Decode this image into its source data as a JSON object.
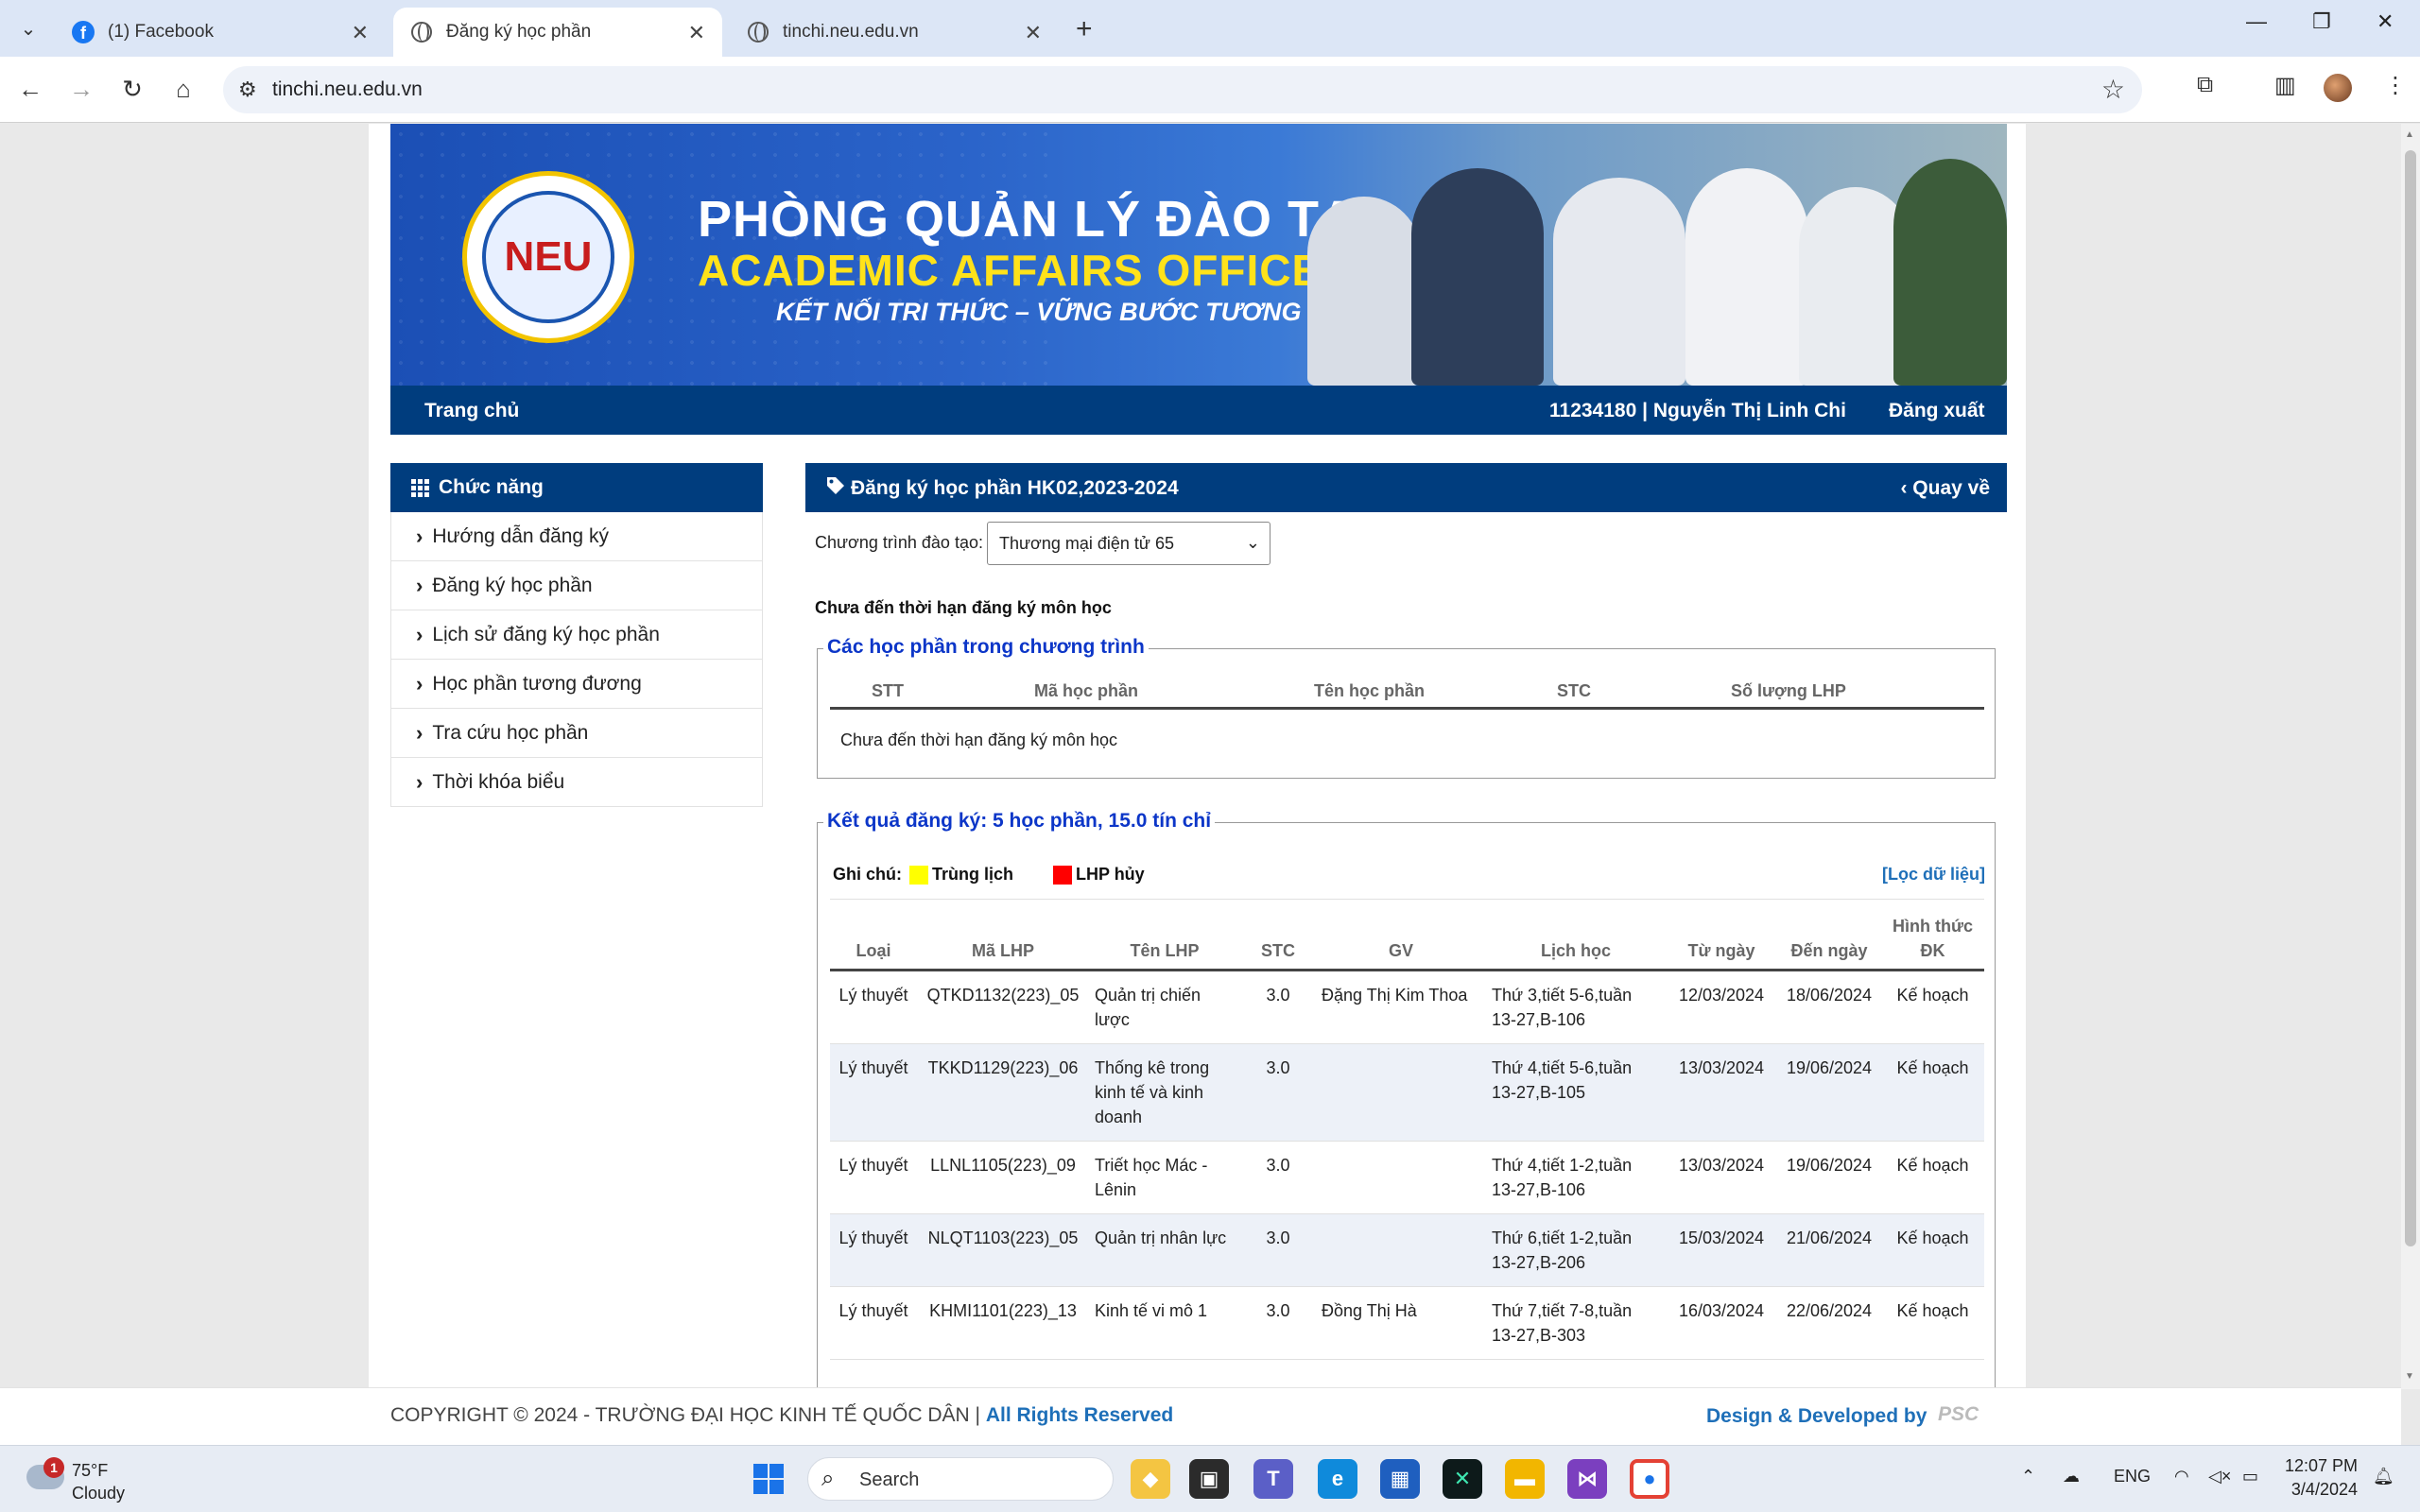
{
  "browser": {
    "tabs": [
      {
        "title": "(1) Facebook",
        "icon": "facebook-icon"
      },
      {
        "title": "Đăng ký học phần",
        "icon": "globe-icon"
      },
      {
        "title": "tinchi.neu.edu.vn",
        "icon": "globe-icon"
      }
    ],
    "url": "tinchi.neu.edu.vn"
  },
  "banner": {
    "line1": "PHÒNG QUẢN LÝ ĐÀO TẠO",
    "line2": "ACADEMIC AFFAIRS OFFICE",
    "line3": "KẾT NỐI TRI THỨC – VỮNG BƯỚC TƯƠNG LAI",
    "logo_text": "NEU"
  },
  "nav": {
    "home": "Trang chủ",
    "user": "11234180 | Nguyễn Thị Linh Chi",
    "logout": "Đăng xuất"
  },
  "sidebar": {
    "title": "Chức năng",
    "items": [
      {
        "label": "Hướng dẫn đăng ký"
      },
      {
        "label": "Đăng ký học phần"
      },
      {
        "label": "Lịch sử đăng ký học phần"
      },
      {
        "label": "Học phần tương đương"
      },
      {
        "label": "Tra cứu học phần"
      },
      {
        "label": "Thời khóa biểu"
      }
    ]
  },
  "main": {
    "title": "Đăng ký học phần HK02,2023-2024",
    "back": "Quay về",
    "program_label": "Chương trình đào tạo:",
    "program_value": "Thương mại điện tử 65",
    "notice": "Chưa đến thời hạn đăng ký môn học",
    "courses_section": {
      "legend": "Các học phần trong chương trình",
      "headers": [
        "STT",
        "Mã học phần",
        "Tên học phần",
        "STC",
        "Số lượng LHP"
      ],
      "empty_text": "Chưa đến thời hạn đăng ký môn học"
    },
    "results_section": {
      "legend": "Kết quả đăng ký: 5 học phần, 15.0 tín chỉ",
      "note_label": "Ghi chú:",
      "note_conflict": "Trùng lịch",
      "note_cancel": "LHP hủy",
      "conflict_color": "#ffff00",
      "cancel_color": "#ff0000",
      "filter": "[Lọc dữ liệu]",
      "headers": [
        "Loại",
        "Mã LHP",
        "Tên LHP",
        "STC",
        "GV",
        "Lịch học",
        "Từ ngày",
        "Đến ngày",
        "Hình thức ĐK"
      ],
      "rows": [
        {
          "type": "Lý thuyết",
          "code": "QTKD1132(223)_05",
          "name": "Quản trị chiến lược",
          "stc": "3.0",
          "gv": "Đặng Thị Kim Thoa",
          "schedule": "Thứ 3,tiết 5-6,tuần 13-27,B-106",
          "from": "12/03/2024",
          "to": "18/06/2024",
          "form": "Kế hoạch"
        },
        {
          "type": "Lý thuyết",
          "code": "TKKD1129(223)_06",
          "name": "Thống kê trong kinh tế và kinh doanh",
          "stc": "3.0",
          "gv": "",
          "schedule": "Thứ 4,tiết 5-6,tuần 13-27,B-105",
          "from": "13/03/2024",
          "to": "19/06/2024",
          "form": "Kế hoạch"
        },
        {
          "type": "Lý thuyết",
          "code": "LLNL1105(223)_09",
          "name": "Triết học Mác - Lênin",
          "stc": "3.0",
          "gv": "",
          "schedule": "Thứ 4,tiết 1-2,tuần 13-27,B-106",
          "from": "13/03/2024",
          "to": "19/06/2024",
          "form": "Kế hoạch"
        },
        {
          "type": "Lý thuyết",
          "code": "NLQT1103(223)_05",
          "name": "Quản trị nhân lực",
          "stc": "3.0",
          "gv": "",
          "schedule": "Thứ 6,tiết 1-2,tuần 13-27,B-206",
          "from": "15/03/2024",
          "to": "21/06/2024",
          "form": "Kế hoạch"
        },
        {
          "type": "Lý thuyết",
          "code": "KHMI1101(223)_13",
          "name": "Kinh tế vi mô 1",
          "stc": "3.0",
          "gv": "Đồng Thị Hà",
          "schedule": "Thứ 7,tiết 7-8,tuần 13-27,B-303",
          "from": "16/03/2024",
          "to": "22/06/2024",
          "form": "Kế hoạch"
        }
      ]
    }
  },
  "footer": {
    "copyright": "COPYRIGHT © 2024 - TRƯỜNG ĐẠI HỌC KINH TẾ QUỐC DÂN |",
    "rights": "All Rights Reserved",
    "developed": "Design & Developed by",
    "company": "PSC"
  },
  "taskbar": {
    "temp": "75°F",
    "condition": "Cloudy",
    "weather_badge": "1",
    "search_placeholder": "Search",
    "lang": "ENG",
    "time": "12:07 PM",
    "date": "3/4/2024"
  }
}
